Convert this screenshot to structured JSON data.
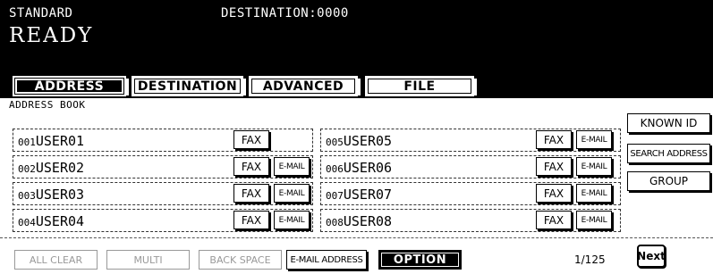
{
  "header": {
    "mode": "STANDARD",
    "destination": "DESTINATION:0000",
    "status": "READY"
  },
  "tabs": [
    {
      "label": "ADDRESS",
      "active": true
    },
    {
      "label": "DESTINATION",
      "active": false
    },
    {
      "label": "ADVANCED",
      "active": false
    },
    {
      "label": "FILE",
      "active": false
    }
  ],
  "section_label": "ADDRESS BOOK",
  "entries": [
    {
      "number": "001",
      "name": "USER01",
      "fax_label": "FAX"
    },
    {
      "number": "002",
      "name": "USER02",
      "fax_label": "FAX",
      "email_label": "E-MAIL"
    },
    {
      "number": "003",
      "name": "USER03",
      "fax_label": "FAX",
      "email_label": "E-MAIL"
    },
    {
      "number": "004",
      "name": "USER04",
      "fax_label": "FAX",
      "email_label": "E-MAIL"
    },
    {
      "number": "005",
      "name": "USER05",
      "fax_label": "FAX",
      "email_label": "E-MAIL"
    },
    {
      "number": "006",
      "name": "USER06",
      "fax_label": "FAX",
      "email_label": "E-MAIL"
    },
    {
      "number": "007",
      "name": "USER07",
      "fax_label": "FAX",
      "email_label": "E-MAIL"
    },
    {
      "number": "008",
      "name": "USER08",
      "fax_label": "FAX",
      "email_label": "E-MAIL"
    }
  ],
  "side_buttons": {
    "known_id": "KNOWN ID",
    "search_address": "SEARCH ADDRESS",
    "group": "GROUP"
  },
  "bottom": {
    "all_clear": "ALL CLEAR",
    "multi": "MULTI",
    "back_space": "BACK SPACE",
    "email_address": "E-MAIL ADDRESS",
    "option": "OPTION",
    "page_indicator": "1/125",
    "next": "Next"
  }
}
